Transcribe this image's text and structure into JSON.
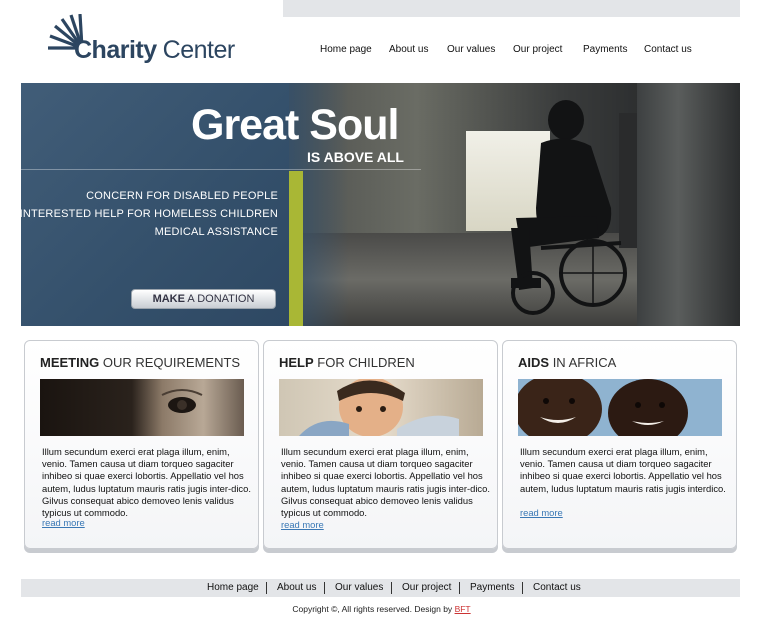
{
  "logo": {
    "bold": "Charity",
    "normal": "Center"
  },
  "topnav": [
    "Home page",
    "About us",
    "Our values",
    "Our project",
    "Payments",
    "Contact us"
  ],
  "hero": {
    "title": "Great Soul",
    "subtitle": "IS ABOVE ALL",
    "list": [
      "CONCERN FOR DISABLED PEOPLE",
      "DISINTERESTED HELP FOR HOMELESS CHILDREN",
      "MEDICAL ASSISTANCE"
    ],
    "donate_bold": "MAKE",
    "donate_rest": "A DONATION",
    "colors": {
      "panel": "#34506b",
      "accent": "#a9b735"
    }
  },
  "cards": [
    {
      "title_bold": "MEETING",
      "title_rest": "OUR REQUIREMENTS",
      "text": "Illum secundum exerci erat plaga illum, enim, venio. Tamen causa ut diam torqueo sagaciter inhibeo si quae exerci lobortis. Appellatio vel hos autem, ludus luptatum mauris ratis jugis inter-dico. Gilvus consequat abico demoveo lenis validus typicus ut commodo.",
      "link": "read more"
    },
    {
      "title_bold": "HELP",
      "title_rest": "FOR CHILDREN",
      "text": "Illum secundum exerci erat plaga illum, enim, venio. Tamen causa ut diam torqueo sagaciter inhibeo si quae exerci lobortis. Appellatio vel hos autem, ludus luptatum mauris ratis jugis inter-dico. Gilvus consequat abico demoveo lenis validus typicus ut commodo.",
      "link": "read more"
    },
    {
      "title_bold": "AIDS",
      "title_rest": "IN AFRICA",
      "text": "Illum secundum exerci erat plaga illum, enim, venio. Tamen causa ut diam torqueo sagaciter inhibeo si quae exerci lobortis. Appellatio vel hos autem, ludus luptatum mauris ratis jugis interdico.",
      "link": "read more"
    }
  ],
  "footnav": [
    "Home page",
    "About us",
    "Our values",
    "Our project",
    "Payments",
    "Contact us"
  ],
  "copyright": {
    "text": "Copyright ©, All rights reserved. Design by",
    "designer": "BFT"
  }
}
